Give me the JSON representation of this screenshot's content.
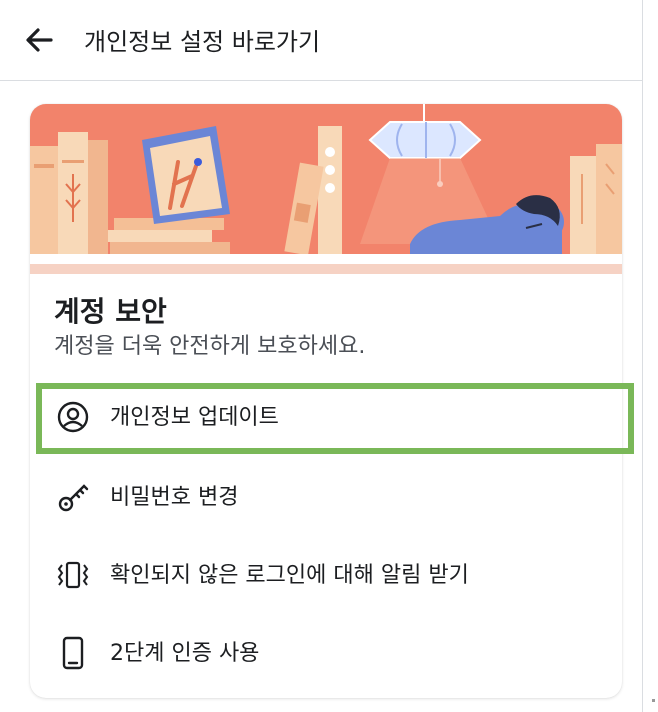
{
  "header": {
    "back_icon": "arrow-left-icon",
    "title": "개인정보 설정 바로가기"
  },
  "section": {
    "title": "계정 보안",
    "subtitle": "계정을 더욱 안전하게 보호하세요."
  },
  "menu": {
    "items": [
      {
        "label": "개인정보 업데이트",
        "icon": "user-circle-icon",
        "highlighted": true
      },
      {
        "label": "비밀번호 변경",
        "icon": "key-icon",
        "highlighted": false
      },
      {
        "label": "확인되지 않은 로그인에 대해 알림 받기",
        "icon": "phone-vibrate-icon",
        "highlighted": false
      },
      {
        "label": "2단계 인증 사용",
        "icon": "smartphone-icon",
        "highlighted": false
      }
    ]
  },
  "colors": {
    "banner_bg": "#f2836b",
    "highlight_border": "#7ab858",
    "text_primary": "#1c1e21",
    "text_secondary": "#4b4f56"
  }
}
